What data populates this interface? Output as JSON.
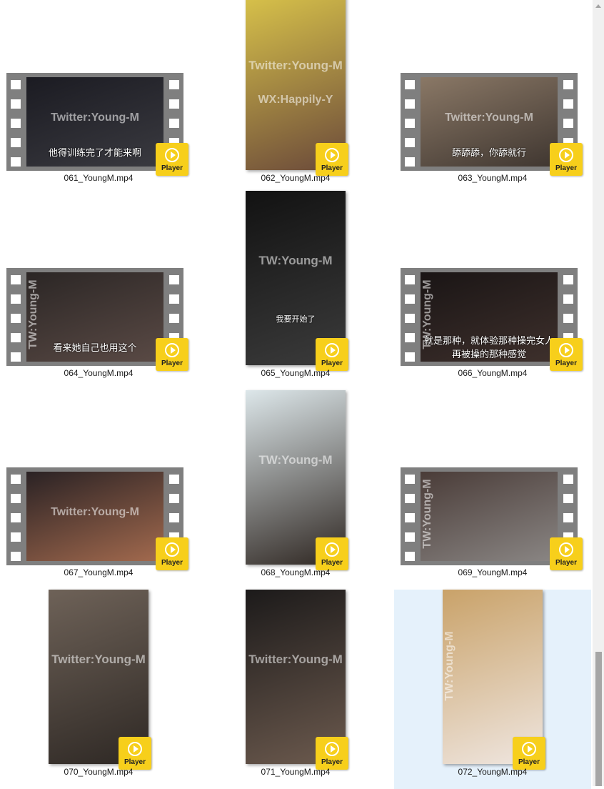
{
  "files": [
    {
      "name": "061_YoungM.mp4",
      "kind": "landscape",
      "watermark": "Twitter:Young-M",
      "subtitle": "他得训练完了才能来啊",
      "player_label": "Player",
      "colors": [
        "#1b1b22",
        "#3a3a40"
      ]
    },
    {
      "name": "062_YoungM.mp4",
      "kind": "portrait",
      "watermark": "Twitter:Young-M",
      "watermark2": "WX:Happily-Y",
      "player_label": "Player",
      "colors": [
        "#d8c24a",
        "#6b4a3a"
      ]
    },
    {
      "name": "063_YoungM.mp4",
      "kind": "landscape",
      "watermark": "Twitter:Young-M",
      "subtitle": "舔舔舔，你舔就行",
      "player_label": "Player",
      "colors": [
        "#8a7866",
        "#3f3630"
      ]
    },
    {
      "name": "064_YoungM.mp4",
      "kind": "landscape",
      "watermark": "TW:Young-M",
      "vertical_wm": true,
      "subtitle": "看来她自己也用这个",
      "player_label": "Player",
      "colors": [
        "#2b2625",
        "#5a4a45"
      ]
    },
    {
      "name": "065_YoungM.mp4",
      "kind": "portrait",
      "watermark": "TW:Young-M",
      "subtitle": "我要开始了",
      "player_label": "Player",
      "colors": [
        "#121212",
        "#3b3b3b"
      ]
    },
    {
      "name": "066_YoungM.mp4",
      "kind": "landscape",
      "watermark": "TW:Young-M",
      "vertical_wm": true,
      "subtitle": "就是那种，就体验那种操完女人",
      "subtitle2": "再被操的那种感觉",
      "player_label": "Player",
      "colors": [
        "#1a1515",
        "#3e302c"
      ]
    },
    {
      "name": "067_YoungM.mp4",
      "kind": "landscape",
      "watermark": "Twitter:Young-M",
      "player_label": "Player",
      "colors": [
        "#2a2224",
        "#a36a4e"
      ]
    },
    {
      "name": "068_YoungM.mp4",
      "kind": "portrait",
      "watermark": "TW:Young-M",
      "player_label": "Player",
      "colors": [
        "#dde7ea",
        "#2f2722"
      ]
    },
    {
      "name": "069_YoungM.mp4",
      "kind": "landscape",
      "watermark": "TW:Young-M",
      "vertical_wm": true,
      "player_label": "Player",
      "colors": [
        "#4a3c38",
        "#8a8684"
      ]
    },
    {
      "name": "070_YoungM.mp4",
      "kind": "portrait",
      "watermark": "Twitter:Young-M",
      "player_label": "Player",
      "colors": [
        "#6e6258",
        "#2e2824"
      ]
    },
    {
      "name": "071_YoungM.mp4",
      "kind": "portrait",
      "watermark": "Twitter:Young-M",
      "player_label": "Player",
      "colors": [
        "#1c1a1a",
        "#6c5a4e"
      ]
    },
    {
      "name": "072_YoungM.mp4",
      "kind": "portrait",
      "watermark": "TW:Young-M",
      "vertical_wm": true,
      "selected": true,
      "player_label": "Player",
      "colors": [
        "#c9a269",
        "#efe6e0"
      ]
    }
  ],
  "theme": {
    "player_color": "#f7cf1b",
    "selection_color": "#e5f1fb",
    "film_color": "#7f7f7f"
  },
  "icons": {
    "play": "play-circle-icon",
    "scroll_up": "chevron-up-icon"
  }
}
